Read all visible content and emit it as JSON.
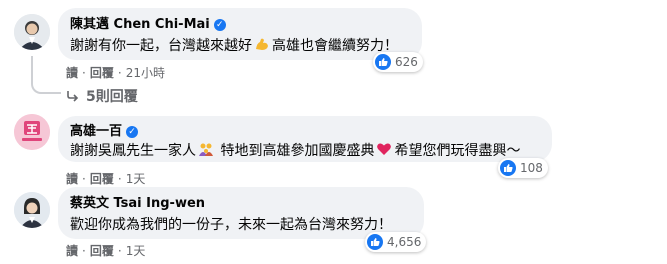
{
  "comments": [
    {
      "author": "陳其邁 Chen Chi-Mai",
      "text_before": "謝謝有你一起，台灣越來越好",
      "text_after": "高雄也會繼續努力！",
      "reactions": "626",
      "time": "21小時",
      "actions": {
        "reply": "讀",
        "repost": "回覆"
      }
    },
    {
      "author": "高雄一百",
      "avatar_text": "高雄一百",
      "text_before": "謝謝吳鳳先生一家人",
      "text_middle": " 特地到高雄參加國慶盛典",
      "text_after": "希望您們玩得盡興～",
      "reactions": "108",
      "time": "1天",
      "actions": {
        "reply": "讀",
        "repost": "回覆"
      }
    },
    {
      "author": "蔡英文 Tsai Ing-wen",
      "text_before": "歡迎你成為我們的一份子，未來一起為台灣來努力！",
      "reactions": "4,656",
      "time": "1天",
      "actions": {
        "reply": "讀",
        "repost": "回覆"
      }
    }
  ],
  "replies_label": "5則回覆",
  "colors": {
    "bubble": "#f0f2f5",
    "like": "#1877f2",
    "secondary_text": "#65676b",
    "brand_pink": "#e0457b"
  }
}
